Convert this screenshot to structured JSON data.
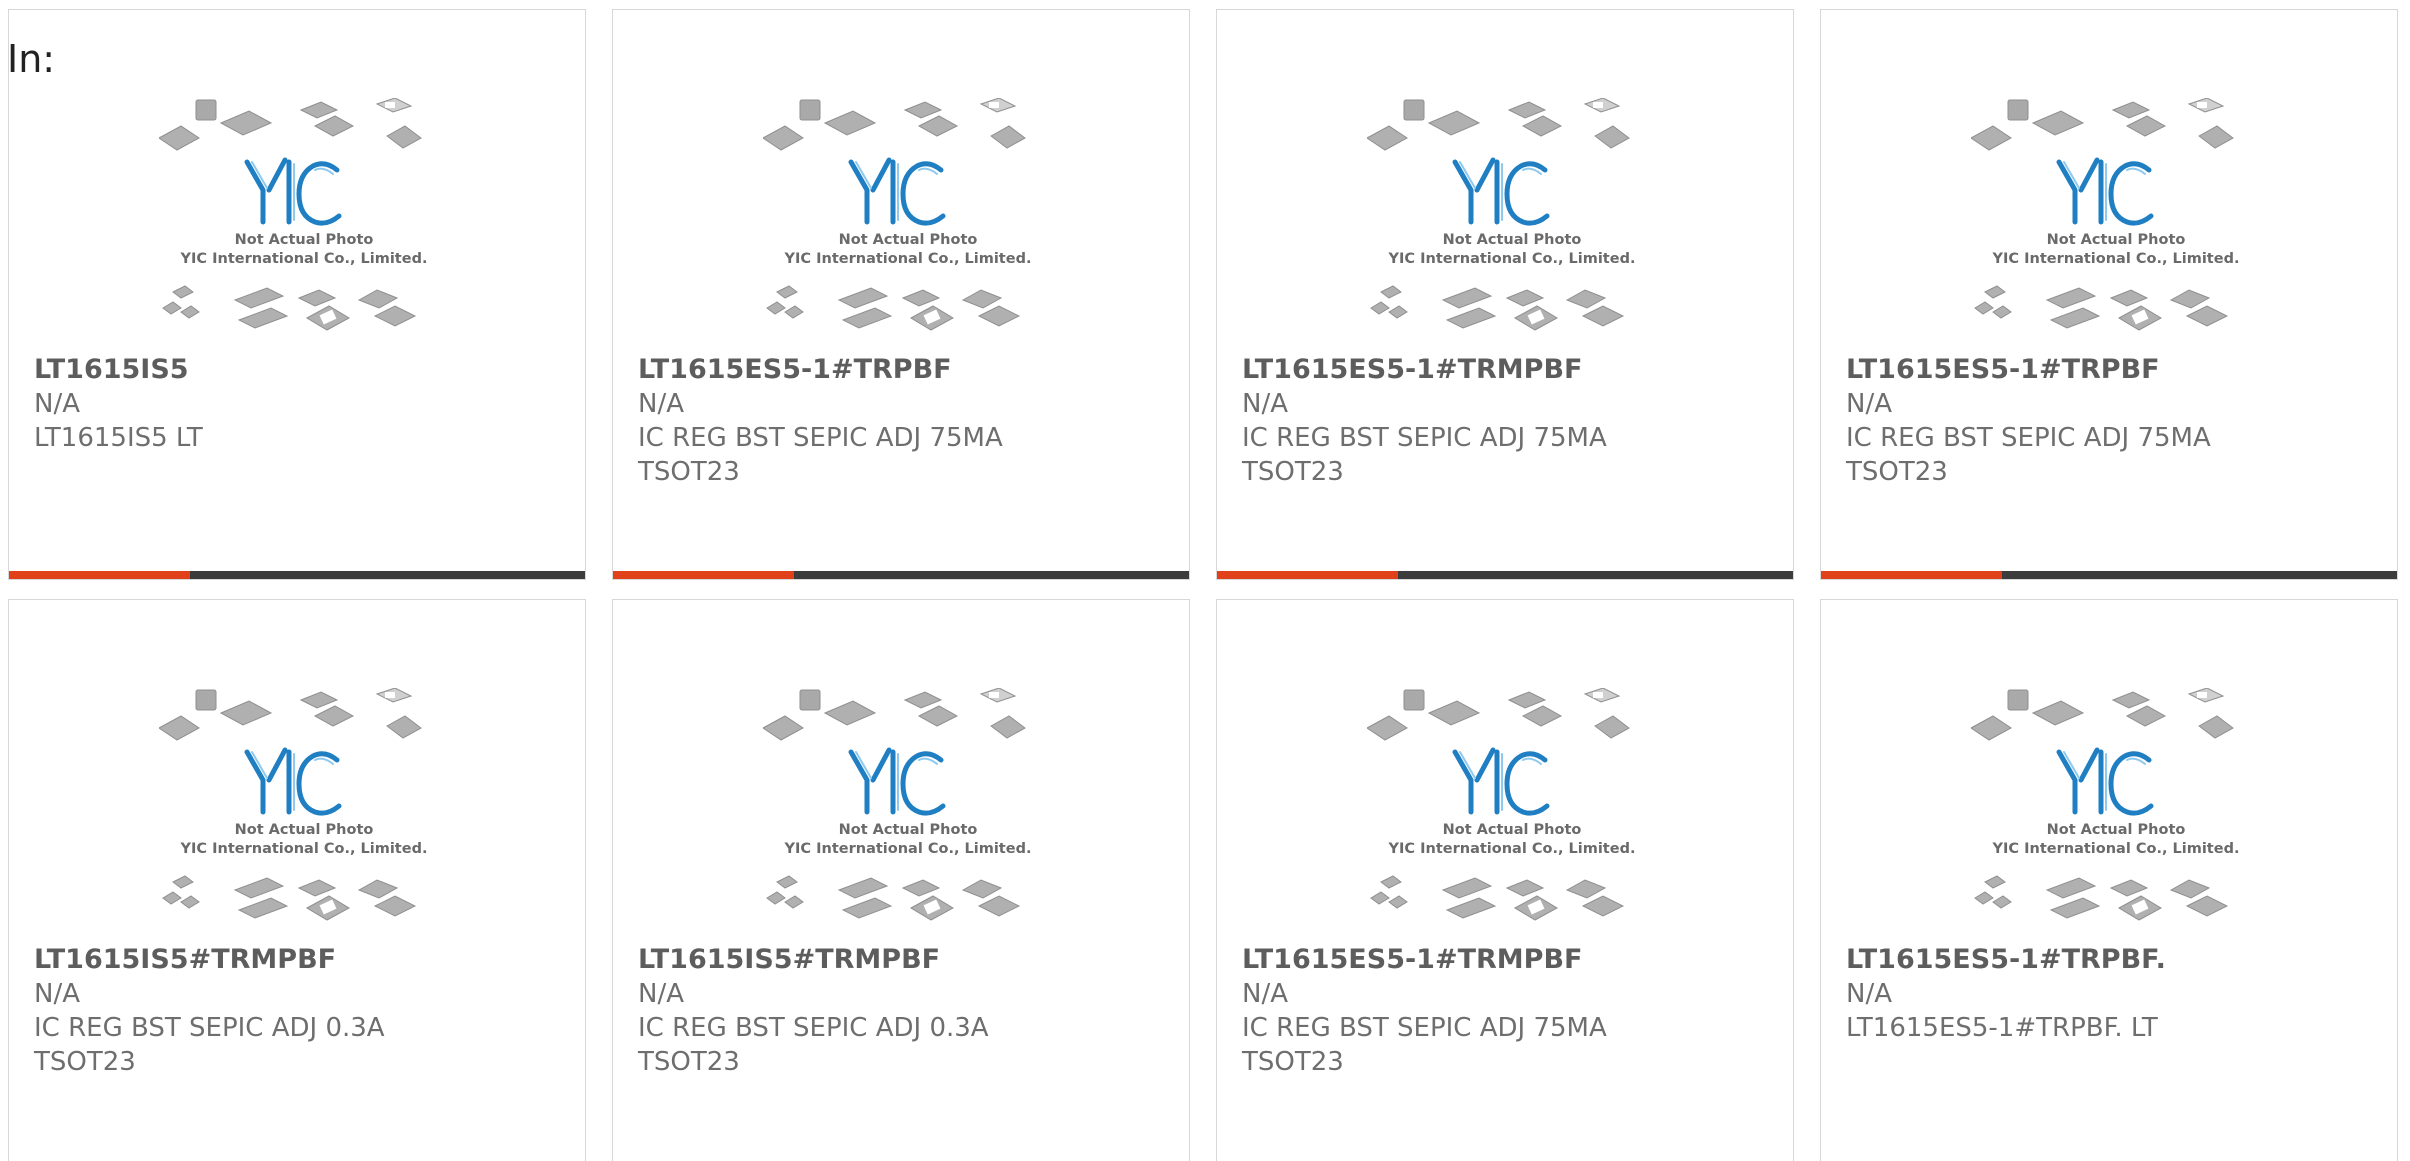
{
  "header": {
    "label": "In:"
  },
  "colors": {
    "accent": "#e0401a",
    "bar": "#3c3c3c",
    "logo": "#1f7fc2"
  },
  "placeholder": {
    "icon": "chip-packages-placeholder-icon",
    "line1": "Not Actual Photo",
    "line2": "YIC International Co., Limited.",
    "logo": "YIC"
  },
  "products": [
    {
      "part": "LT1615IS5",
      "mfr": "N/A",
      "desc1": "LT1615IS5 LT",
      "desc2": ""
    },
    {
      "part": "LT1615ES5-1#TRPBF",
      "mfr": "N/A",
      "desc1": "IC REG BST SEPIC ADJ 75MA",
      "desc2": "TSOT23"
    },
    {
      "part": "LT1615ES5-1#TRMPBF",
      "mfr": "N/A",
      "desc1": "IC REG BST SEPIC ADJ 75MA",
      "desc2": "TSOT23"
    },
    {
      "part": "LT1615ES5-1#TRPBF",
      "mfr": "N/A",
      "desc1": "IC REG BST SEPIC ADJ 75MA",
      "desc2": "TSOT23"
    },
    {
      "part": "LT1615IS5#TRMPBF",
      "mfr": "N/A",
      "desc1": "IC REG BST SEPIC ADJ 0.3A",
      "desc2": "TSOT23"
    },
    {
      "part": "LT1615IS5#TRMPBF",
      "mfr": "N/A",
      "desc1": "IC REG BST SEPIC ADJ 0.3A",
      "desc2": "TSOT23"
    },
    {
      "part": "LT1615ES5-1#TRMPBF",
      "mfr": "N/A",
      "desc1": "IC REG BST SEPIC ADJ 75MA",
      "desc2": "TSOT23"
    },
    {
      "part": "LT1615ES5-1#TRPBF.",
      "mfr": "N/A",
      "desc1": "LT1615ES5-1#TRPBF. LT",
      "desc2": ""
    }
  ]
}
